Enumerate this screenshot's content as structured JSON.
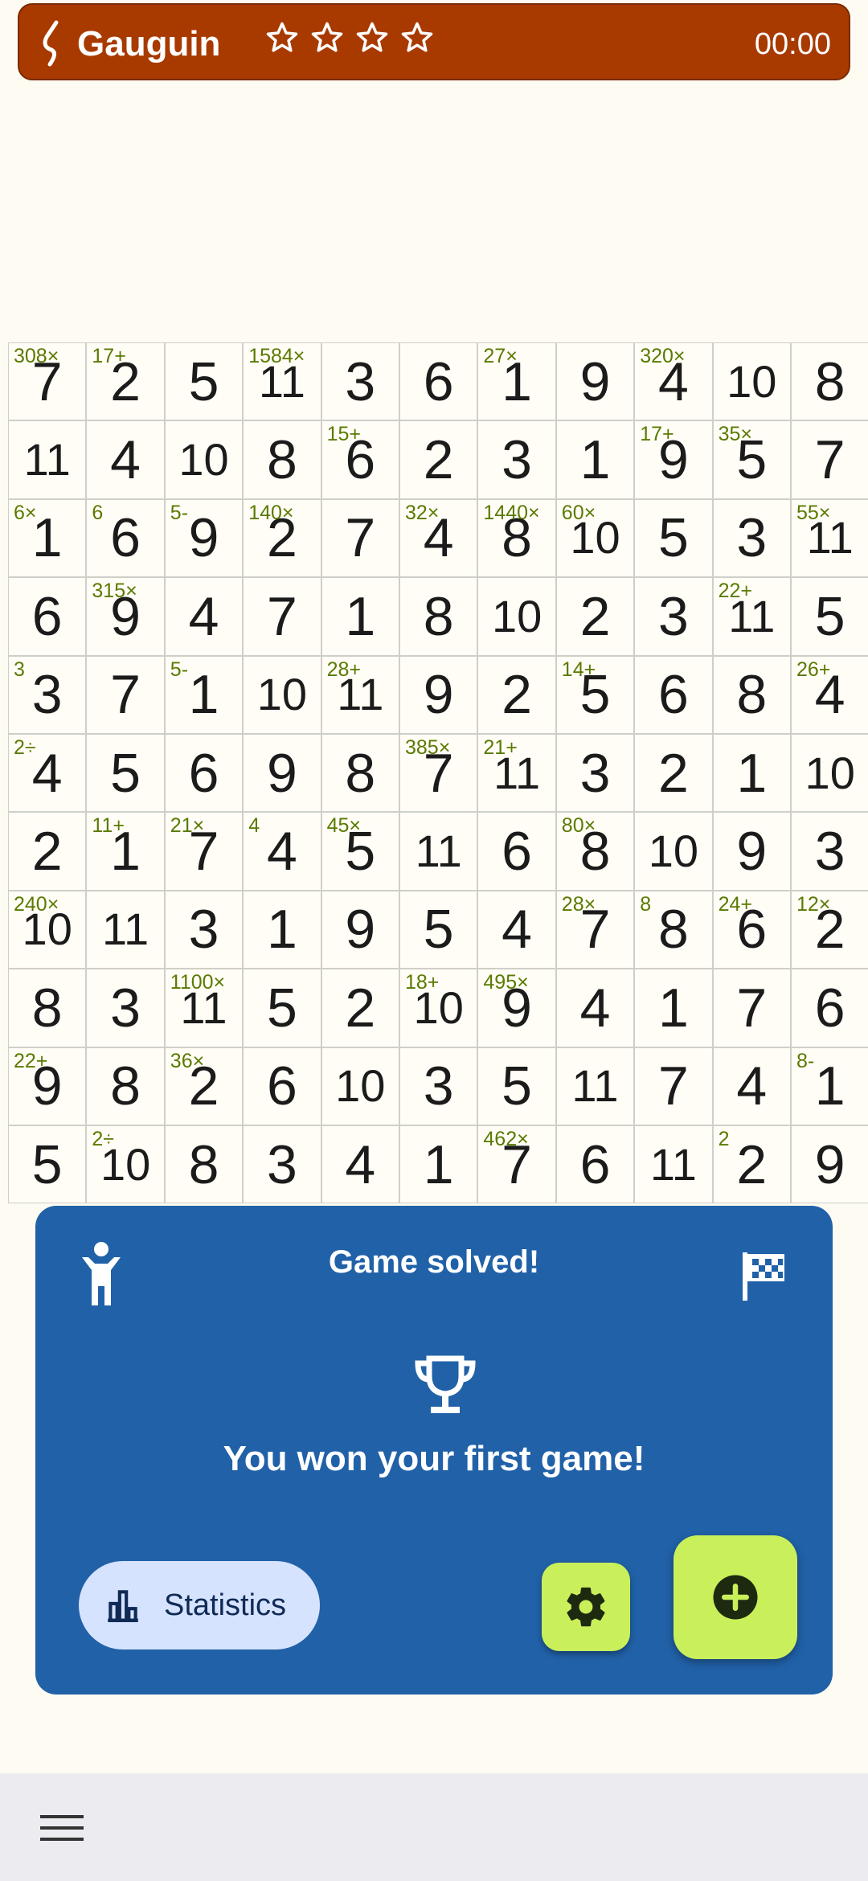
{
  "app": {
    "title": "Gauguin",
    "timer": "00:00",
    "stars_filled": 0,
    "stars_total": 4
  },
  "grid": {
    "size": 11,
    "values": [
      [
        "7",
        "2",
        "5",
        "11",
        "3",
        "6",
        "1",
        "9",
        "4",
        "10",
        "8"
      ],
      [
        "11",
        "4",
        "10",
        "8",
        "6",
        "2",
        "3",
        "1",
        "9",
        "5",
        "7"
      ],
      [
        "1",
        "6",
        "9",
        "2",
        "7",
        "4",
        "8",
        "10",
        "5",
        "3",
        "11"
      ],
      [
        "6",
        "9",
        "4",
        "7",
        "1",
        "8",
        "10",
        "2",
        "3",
        "11",
        "5"
      ],
      [
        "3",
        "7",
        "1",
        "10",
        "11",
        "9",
        "2",
        "5",
        "6",
        "8",
        "4"
      ],
      [
        "4",
        "5",
        "6",
        "9",
        "8",
        "7",
        "11",
        "3",
        "2",
        "1",
        "10"
      ],
      [
        "2",
        "1",
        "7",
        "4",
        "5",
        "11",
        "6",
        "8",
        "10",
        "9",
        "3"
      ],
      [
        "10",
        "11",
        "3",
        "1",
        "9",
        "5",
        "4",
        "7",
        "8",
        "6",
        "2"
      ],
      [
        "8",
        "3",
        "11",
        "5",
        "2",
        "10",
        "9",
        "4",
        "1",
        "7",
        "6"
      ],
      [
        "9",
        "8",
        "2",
        "6",
        "10",
        "3",
        "5",
        "11",
        "7",
        "4",
        "1"
      ],
      [
        "5",
        "10",
        "8",
        "3",
        "4",
        "1",
        "7",
        "6",
        "11",
        "2",
        "9"
      ]
    ],
    "cage_labels": [
      {
        "r": 0,
        "c": 0,
        "label": "308×"
      },
      {
        "r": 0,
        "c": 1,
        "label": "17+"
      },
      {
        "r": 0,
        "c": 3,
        "label": "1584×"
      },
      {
        "r": 0,
        "c": 6,
        "label": "27×"
      },
      {
        "r": 0,
        "c": 8,
        "label": "320×"
      },
      {
        "r": 1,
        "c": 4,
        "label": "15+"
      },
      {
        "r": 1,
        "c": 8,
        "label": "17+"
      },
      {
        "r": 1,
        "c": 9,
        "label": "35×"
      },
      {
        "r": 2,
        "c": 0,
        "label": "6×"
      },
      {
        "r": 2,
        "c": 1,
        "label": "6"
      },
      {
        "r": 2,
        "c": 2,
        "label": "5-"
      },
      {
        "r": 2,
        "c": 3,
        "label": "140×"
      },
      {
        "r": 2,
        "c": 5,
        "label": "32×"
      },
      {
        "r": 2,
        "c": 6,
        "label": "1440×"
      },
      {
        "r": 2,
        "c": 7,
        "label": "60×"
      },
      {
        "r": 2,
        "c": 10,
        "label": "55×"
      },
      {
        "r": 3,
        "c": 1,
        "label": "315×"
      },
      {
        "r": 3,
        "c": 9,
        "label": "22+"
      },
      {
        "r": 4,
        "c": 0,
        "label": "3"
      },
      {
        "r": 4,
        "c": 2,
        "label": "5-"
      },
      {
        "r": 4,
        "c": 4,
        "label": "28+"
      },
      {
        "r": 4,
        "c": 7,
        "label": "14+"
      },
      {
        "r": 4,
        "c": 10,
        "label": "26+"
      },
      {
        "r": 5,
        "c": 0,
        "label": "2÷"
      },
      {
        "r": 5,
        "c": 5,
        "label": "385×"
      },
      {
        "r": 5,
        "c": 6,
        "label": "21+"
      },
      {
        "r": 6,
        "c": 1,
        "label": "11+"
      },
      {
        "r": 6,
        "c": 2,
        "label": "21×"
      },
      {
        "r": 6,
        "c": 3,
        "label": "4"
      },
      {
        "r": 6,
        "c": 4,
        "label": "45×"
      },
      {
        "r": 6,
        "c": 7,
        "label": "80×"
      },
      {
        "r": 7,
        "c": 0,
        "label": "240×"
      },
      {
        "r": 7,
        "c": 7,
        "label": "28×"
      },
      {
        "r": 7,
        "c": 8,
        "label": "8"
      },
      {
        "r": 7,
        "c": 9,
        "label": "24+"
      },
      {
        "r": 7,
        "c": 10,
        "label": "12×"
      },
      {
        "r": 8,
        "c": 2,
        "label": "1100×"
      },
      {
        "r": 8,
        "c": 5,
        "label": "18+"
      },
      {
        "r": 8,
        "c": 6,
        "label": "495×"
      },
      {
        "r": 9,
        "c": 0,
        "label": "22+"
      },
      {
        "r": 9,
        "c": 2,
        "label": "36×"
      },
      {
        "r": 9,
        "c": 10,
        "label": "8-"
      },
      {
        "r": 10,
        "c": 1,
        "label": "2÷"
      },
      {
        "r": 10,
        "c": 6,
        "label": "462×"
      },
      {
        "r": 10,
        "c": 9,
        "label": "2"
      }
    ]
  },
  "panel": {
    "title": "Game solved!",
    "message": "You won your first game!",
    "statistics_label": "Statistics"
  },
  "colors": {
    "topbar": "#A83A00",
    "panel": "#2161A8",
    "accent_button": "#C9F05A",
    "stats_button": "#D6E3FF",
    "cage_label": "#5A7A00"
  },
  "icons": [
    "app-logo-icon",
    "star-icon",
    "person-icon",
    "flag-icon",
    "trophy-icon",
    "bar-chart-icon",
    "gear-icon",
    "add-circle-icon",
    "menu-icon"
  ]
}
